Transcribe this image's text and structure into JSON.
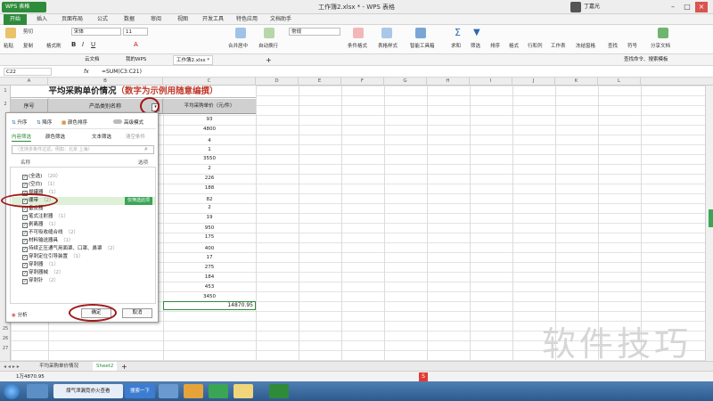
{
  "app": {
    "name": "WPS 表格",
    "window_title": "工作簿2.xlsx * - WPS 表格",
    "user": "丁嘉光"
  },
  "menu": {
    "tabs": [
      "开始",
      "插入",
      "页面布局",
      "公式",
      "数据",
      "审阅",
      "视图",
      "开发工具",
      "特色应用",
      "文档助手"
    ],
    "active": 0
  },
  "ribbon": {
    "clipboard": {
      "paste": "粘贴",
      "cut": "剪切",
      "copy": "复制",
      "format_painter": "格式刷"
    },
    "font": {
      "name": "宋体",
      "size": "11"
    },
    "merge": "合并居中",
    "wrap": "自动换行",
    "number_format": "常规",
    "cond_format": "条件格式",
    "table_style": "表格样式",
    "tool_box": "智能工具箱",
    "sum": "求和",
    "filter": "筛选",
    "sort": "排序",
    "format": "格式",
    "rowcol": "行和列",
    "worksheet": "工作表",
    "freeze": "冻结窗格",
    "find": "查找",
    "symbol": "符号",
    "share": "分享文档"
  },
  "quickbar": {
    "cloud": "云文档",
    "my_wps": "我的WPS",
    "doc_tab": "工作簿2.xlsx *",
    "search": "查找命令、搜索模板"
  },
  "formula": {
    "cell": "C22",
    "fx": "fx",
    "content": "=SUM(C3:C21)"
  },
  "columns": [
    "A",
    "B",
    "C",
    "D",
    "E",
    "F",
    "G",
    "H",
    "I",
    "J",
    "K",
    "L"
  ],
  "sheet": {
    "title": "平均采购单价情况",
    "title_note": "（数字为示例用随意编撰）",
    "headers": {
      "a": "序号",
      "b": "产品类别名称",
      "c": "平均采购单价（元/件）"
    },
    "values": [
      "93",
      "4800",
      "4",
      "1",
      "3550",
      "2",
      "226",
      "188",
      "82",
      "2",
      "19",
      "950",
      "175",
      "400",
      "17",
      "275",
      "184",
      "453",
      "3450"
    ],
    "total": "14870.95"
  },
  "filter_popup": {
    "sort_asc": "升序",
    "sort_desc": "降序",
    "sort_color": "颜色排序",
    "advanced": "高级模式",
    "tab_content": "内容筛选",
    "tab_color": "颜色筛选",
    "tab_text": "文本筛选",
    "clear": "清空条件",
    "search_placeholder": "（支持多条件过滤，例如：北京 上海）",
    "name_label": "名称",
    "options_label": "选项",
    "items": [
      {
        "label": "(全选)",
        "count": "（20）",
        "checked": true
      },
      {
        "label": "(空白)",
        "count": "（1）",
        "checked": true
      },
      {
        "label": "拔罐器",
        "count": "（1）",
        "checked": true
      },
      {
        "label": "绷带",
        "count": "（2）",
        "checked": true
      },
      {
        "label": "备皮器",
        "count": "",
        "checked": true
      },
      {
        "label": "笔式注射器",
        "count": "（1）",
        "checked": true
      },
      {
        "label": "剥离器",
        "count": "（1）",
        "checked": true
      },
      {
        "label": "不可吸收缝合线",
        "count": "（2）",
        "checked": true
      },
      {
        "label": "材料输送器具",
        "count": "（1）",
        "checked": true
      },
      {
        "label": "持续正压通气用面罩、口罩、鼻罩",
        "count": "（2）",
        "checked": true
      },
      {
        "label": "穿刺定位引导装置",
        "count": "（1）",
        "checked": true
      },
      {
        "label": "穿刺器",
        "count": "（1）",
        "checked": true
      },
      {
        "label": "穿刺器械",
        "count": "（2）",
        "checked": true
      },
      {
        "label": "穿刺针",
        "count": "（2）",
        "checked": true
      }
    ],
    "only_this": "仅筛选此项",
    "analysis": "分析",
    "ok": "确定",
    "cancel": "取消"
  },
  "sheet_tabs": [
    "平均采购单价情况",
    "Sheet2"
  ],
  "status": {
    "sum": "1万4870.95"
  },
  "taskbar": {
    "browser_tab": "煤气泄漏竟亦火查看",
    "search": "搜索一下"
  },
  "watermark": "软件技巧",
  "colors": {
    "accent": "#2e8b3a",
    "title_red": "#c0392b",
    "circle": "#a01a1a"
  }
}
